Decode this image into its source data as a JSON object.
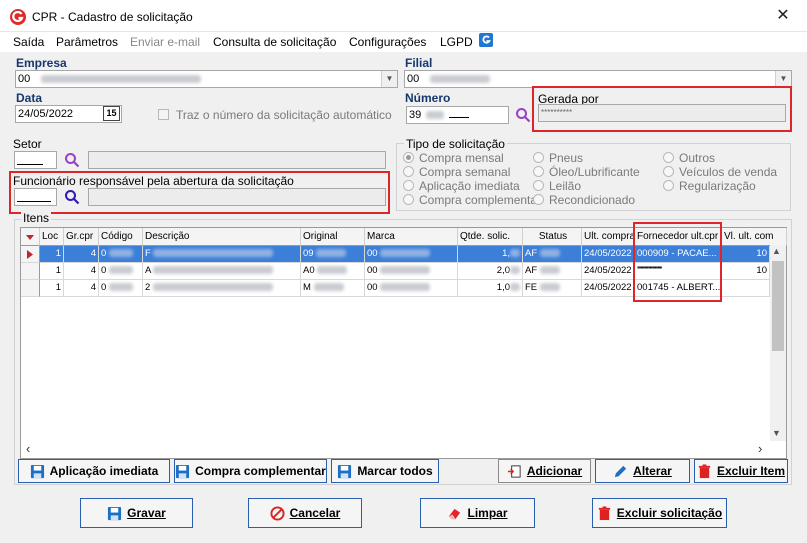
{
  "window": {
    "title": "CPR - Cadastro de solicitação",
    "close": "✕"
  },
  "menu": [
    {
      "label": "Saída",
      "enabled": true
    },
    {
      "label": "Parâmetros",
      "enabled": true
    },
    {
      "label": "Enviar e-mail",
      "enabled": false
    },
    {
      "label": "Consulta de solicitação",
      "enabled": true
    },
    {
      "label": "Configurações",
      "enabled": true
    },
    {
      "label": "LGPD",
      "enabled": true
    }
  ],
  "form": {
    "empresa_label": "Empresa",
    "empresa_value": "00",
    "filial_label": "Filial",
    "filial_value": "00",
    "data_label": "Data",
    "data_value": "24/05/2022",
    "calendar_label": "15",
    "auto_number_label": "Traz o número da solicitação automático",
    "numero_label": "Número",
    "numero_value": "39",
    "gerada_por_label": "Gerada por",
    "gerada_por_value": "**********",
    "setor_label": "Setor",
    "funcionario_label": "Funcionário responsável pela abertura da solicitação",
    "tipo_label": "Tipo de solicitação",
    "tipo_options": [
      {
        "label": "Compra mensal",
        "checked": true
      },
      {
        "label": "Compra semanal",
        "checked": false
      },
      {
        "label": "Aplicação imediata",
        "checked": false
      },
      {
        "label": "Compra complementar",
        "checked": false
      },
      {
        "label": "Pneus",
        "checked": false
      },
      {
        "label": "Óleo/Lubrificante",
        "checked": false
      },
      {
        "label": "Leilão",
        "checked": false
      },
      {
        "label": "Recondicionado",
        "checked": false
      },
      {
        "label": "Outros",
        "checked": false
      },
      {
        "label": "Veículos de venda",
        "checked": false
      },
      {
        "label": "Regularização",
        "checked": false
      }
    ],
    "itens_label": "Itens"
  },
  "grid": {
    "headers": [
      "Loc",
      "Gr.cpr",
      "Código",
      "Descrição",
      "Original",
      "Marca",
      "Qtde. solic.",
      "Status",
      "Ult. compra",
      "Fornecedor ult.cpr",
      "Vl. ult. com"
    ],
    "rows": [
      {
        "loc": "1",
        "gr": "4",
        "codigo": "0",
        "descricao": "F",
        "original": "09",
        "marca": "00",
        "qtde": "1,",
        "status": "AF",
        "ult_compra": "24/05/2022",
        "fornecedor": "000909 - PACAE...",
        "vl": "10",
        "selected": true
      },
      {
        "loc": "1",
        "gr": "4",
        "codigo": "0",
        "descricao": "A",
        "original": "A0",
        "marca": "00",
        "qtde": "2,0",
        "status": "AF",
        "ult_compra": "24/05/2022",
        "fornecedor": "''''''''''''''''''''''''''''''",
        "vl": "10",
        "selected": false
      },
      {
        "loc": "1",
        "gr": "4",
        "codigo": "0",
        "descricao": "2",
        "original": "M",
        "marca": "00",
        "qtde": "1,0",
        "status": "FE",
        "ult_compra": "24/05/2022",
        "fornecedor": "001745 - ALBERT...",
        "vl": "",
        "selected": false
      }
    ]
  },
  "item_buttons": {
    "aplicacao": "Aplicação imediata",
    "complementar": "Compra complementar",
    "marcar": "Marcar todos",
    "adicionar": "Adicionar",
    "alterar": "Alterar",
    "excluir_item": "Excluir Item"
  },
  "footer_buttons": {
    "gravar": "Gravar",
    "cancelar": "Cancelar",
    "limpar": "Limpar",
    "excluir_solicitacao": "Excluir solicitação"
  },
  "colors": {
    "accent": "#17376c",
    "highlight_box": "#e0252a",
    "selection": "#3c7fd8"
  }
}
